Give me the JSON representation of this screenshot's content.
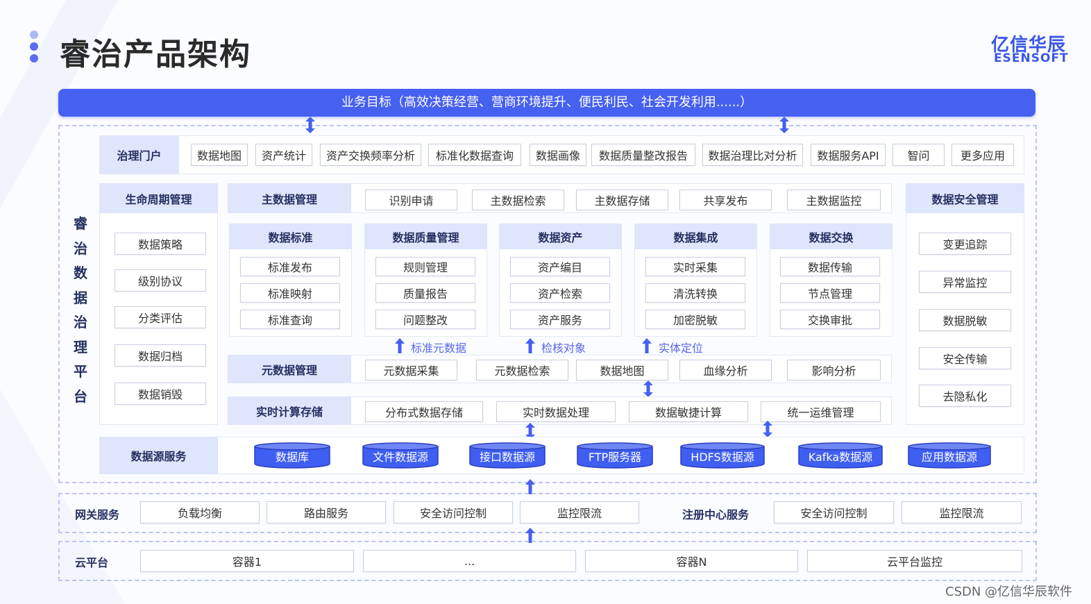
{
  "header": {
    "title": "睿治产品架构",
    "logo_cn": "亿信华辰",
    "logo_en": "ESENSOFT"
  },
  "banner": "业务目标（高效决策经营、营商环境提升、便民利民、社会开发利用......）",
  "platform_vertical_title": [
    "睿",
    "治",
    "数",
    "据",
    "治",
    "理",
    "平",
    "台"
  ],
  "governance_portal": {
    "label": "治理门户",
    "items": [
      "数据地图",
      "资产统计",
      "资产交换频率分析",
      "标准化数据查询",
      "数据画像",
      "数据质量整改报告",
      "数据治理比对分析",
      "数据服务API",
      "智问",
      "更多应用"
    ]
  },
  "lifecycle": {
    "label": "生命周期管理",
    "items": [
      "数据策略",
      "级别协议",
      "分类评估",
      "数据归档",
      "数据销毁"
    ]
  },
  "master_data": {
    "label": "主数据管理",
    "items": [
      "识别申请",
      "主数据检索",
      "主数据存储",
      "共享发布",
      "主数据监控"
    ]
  },
  "modules": [
    {
      "label": "数据标准",
      "items": [
        "标准发布",
        "标准映射",
        "标准查询"
      ]
    },
    {
      "label": "数据质量管理",
      "items": [
        "规则管理",
        "质量报告",
        "问题整改"
      ]
    },
    {
      "label": "数据资产",
      "items": [
        "资产编目",
        "资产检索",
        "资产服务"
      ]
    },
    {
      "label": "数据集成",
      "items": [
        "实时采集",
        "清洗转换",
        "加密脱敏"
      ]
    },
    {
      "label": "数据交换",
      "items": [
        "数据传输",
        "节点管理",
        "交换审批"
      ]
    }
  ],
  "flow_labels": [
    "标准元数据",
    "检核对象",
    "实体定位"
  ],
  "metadata": {
    "label": "元数据管理",
    "items": [
      "元数据采集",
      "元数据检索",
      "数据地图",
      "血缘分析",
      "影响分析"
    ]
  },
  "realtime": {
    "label": "实时计算存储",
    "items": [
      "分布式数据存储",
      "实时数据处理",
      "数据敏捷计算",
      "统一运维管理"
    ]
  },
  "security": {
    "label": "数据安全管理",
    "items": [
      "变更追踪",
      "异常监控",
      "数据脱敏",
      "安全传输",
      "去隐私化"
    ]
  },
  "datasource": {
    "label": "数据源服务",
    "items": [
      "数据库",
      "文件数据源",
      "接口数据源",
      "FTP服务器",
      "HDFS数据源",
      "Kafka数据源",
      "应用数据源"
    ]
  },
  "gateway": {
    "label": "网关服务",
    "items": [
      "负载均衡",
      "路由服务",
      "安全访问控制",
      "监控限流"
    ],
    "registry_label": "注册中心服务",
    "registry_items": [
      "安全访问控制",
      "监控限流"
    ]
  },
  "cloud": {
    "label": "云平台",
    "items": [
      "容器1",
      "...",
      "容器N",
      "云平台监控"
    ]
  },
  "watermark": "CSDN @亿信华辰软件",
  "colors": {
    "accent": "#4660f0",
    "header_fill": "#dfe5fb",
    "dashed_border": "#b9c4f5",
    "cylinder": "#3f5ef2"
  }
}
